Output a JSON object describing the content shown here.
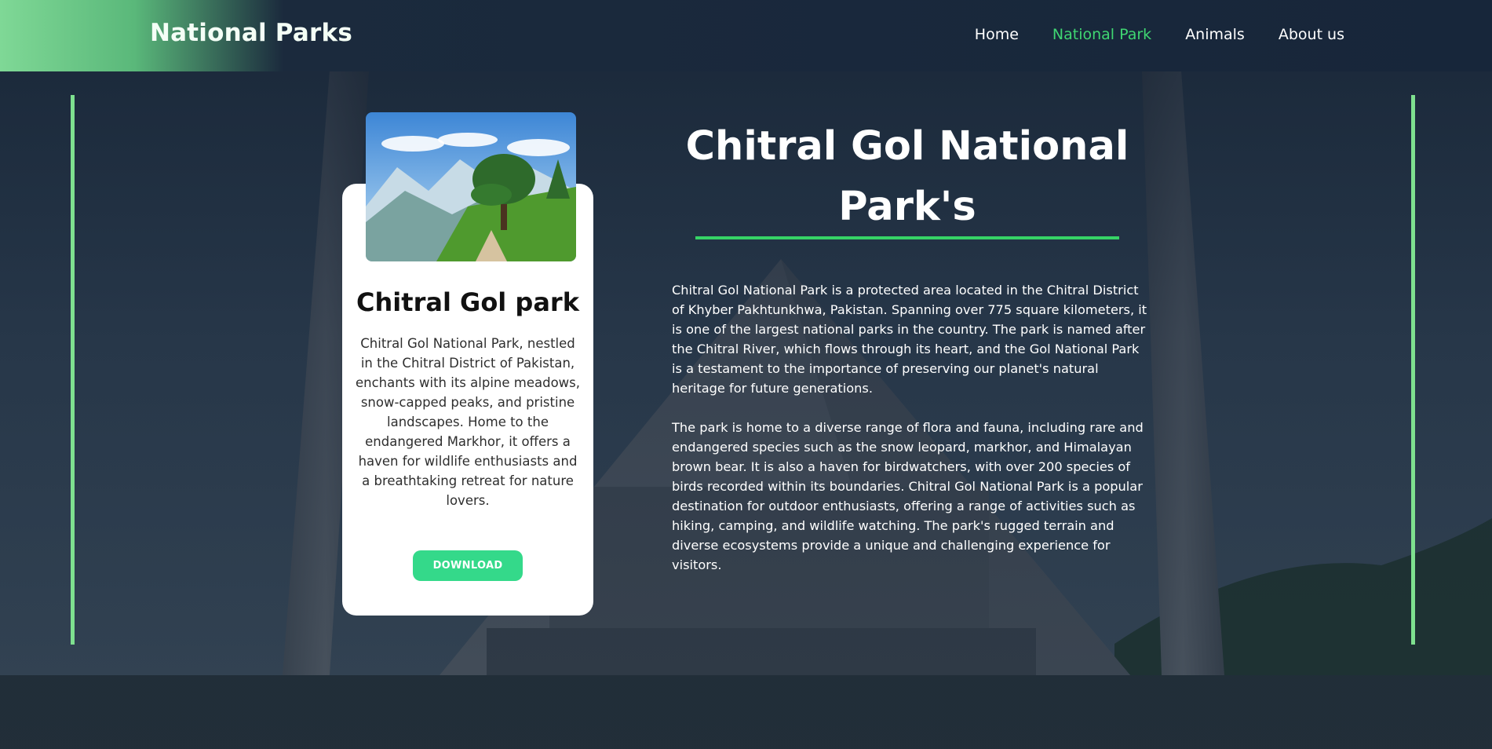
{
  "header": {
    "brand": "National Parks",
    "nav": [
      {
        "label": "Home",
        "active": false
      },
      {
        "label": "National Park",
        "active": true
      },
      {
        "label": "Animals",
        "active": false
      },
      {
        "label": "About us",
        "active": false
      }
    ]
  },
  "card": {
    "image_icon": "mountain-landscape-photo",
    "title": "Chitral Gol park",
    "description": "Chitral Gol National Park, nestled in the Chitral District of Pakistan, enchants with its alpine meadows, snow-capped peaks, and pristine landscapes. Home to the endangered Markhor, it offers a haven for wildlife enthusiasts and a breathtaking retreat for nature lovers.",
    "button_label": "DOWNLOAD"
  },
  "article": {
    "title": "Chitral Gol National Park's",
    "paragraphs": [
      "Chitral Gol National Park is a protected area located in the Chitral District of Khyber Pakhtunkhwa, Pakistan. Spanning over 775 square kilometers, it is one of the largest national parks in the country. The park is named after the Chitral River, which flows through its heart, and the Gol National Park is a testament to the importance of preserving our planet's natural heritage for future generations.",
      "The park is home to a diverse range of flora and fauna, including rare and endangered species such as the snow leopard, markhor, and Himalayan brown bear. It is also a haven for birdwatchers, with over 200 species of birds recorded within its boundaries. Chitral Gol National Park is a popular destination for outdoor enthusiasts, offering a range of activities such as hiking, camping, and wildlife watching. The park's rugged terrain and diverse ecosystems provide a unique and challenging experience for visitors."
    ]
  },
  "colors": {
    "accent_green": "#36d466",
    "nav_active": "#3fd672",
    "side_line": "#7ee08f",
    "button": "#34d98a",
    "header_bg": "#17263a"
  }
}
